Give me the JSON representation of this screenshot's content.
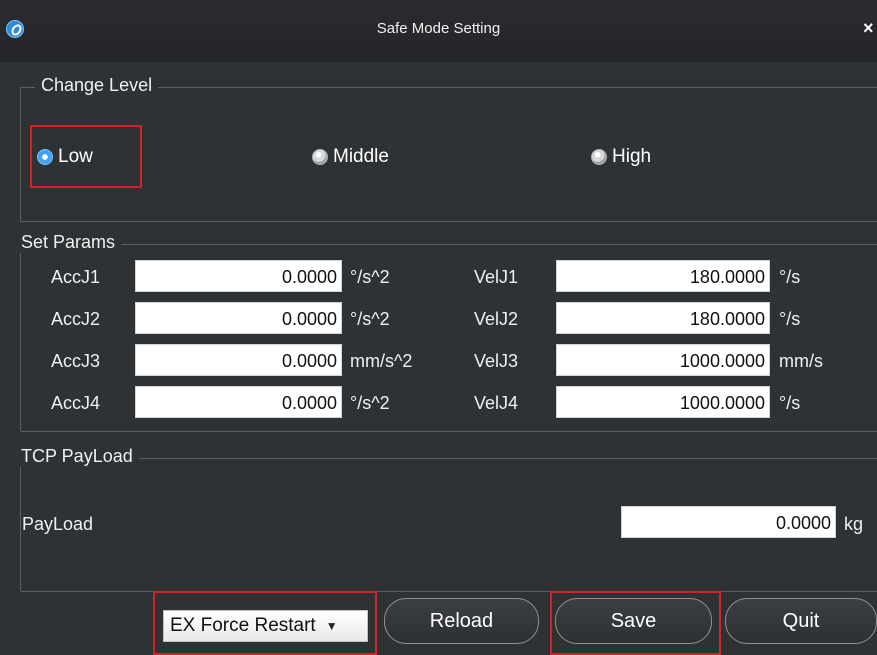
{
  "window": {
    "title": "Safe Mode Setting"
  },
  "change_level": {
    "title": "Change Level",
    "options": [
      "Low",
      "Middle",
      "High"
    ],
    "selected": "Low"
  },
  "params": {
    "title": "Set Params",
    "rows": [
      {
        "label": "AccJ1",
        "value": "0.0000",
        "unit": "°/s^2",
        "vel_label": "VelJ1",
        "vel_value": "180.0000",
        "vel_unit": "°/s"
      },
      {
        "label": "AccJ2",
        "value": "0.0000",
        "unit": "°/s^2",
        "vel_label": "VelJ2",
        "vel_value": "180.0000",
        "vel_unit": "°/s"
      },
      {
        "label": "AccJ3",
        "value": "0.0000",
        "unit": "mm/s^2",
        "vel_label": "VelJ3",
        "vel_value": "1000.0000",
        "vel_unit": "mm/s"
      },
      {
        "label": "AccJ4",
        "value": "0.0000",
        "unit": "°/s^2",
        "vel_label": "VelJ4",
        "vel_value": "1000.0000",
        "vel_unit": "°/s"
      }
    ]
  },
  "payload": {
    "title": "TCP PayLoad",
    "label": "PayLoad",
    "value": "0.0000",
    "unit": "kg"
  },
  "footer": {
    "dropdown": "EX Force Restart",
    "reload": "Reload",
    "save": "Save",
    "quit": "Quit"
  },
  "icons": {
    "app": "app-logo-icon",
    "close": "close-icon",
    "dropdown": "chevron-down-icon"
  },
  "colors": {
    "accent": "#41a2f3",
    "highlight": "#d3222a",
    "background": "#2f3235"
  }
}
